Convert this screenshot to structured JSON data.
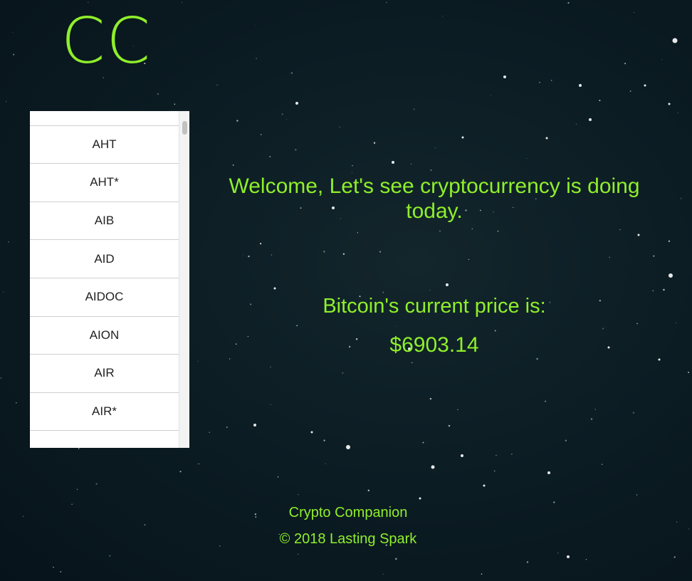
{
  "brand": {
    "logo_text": "CC",
    "accent_color": "#8fef2a"
  },
  "coin_list": {
    "items": [
      {
        "label": ""
      },
      {
        "label": "AHT"
      },
      {
        "label": "AHT*"
      },
      {
        "label": "AIB"
      },
      {
        "label": "AID"
      },
      {
        "label": "AIDOC"
      },
      {
        "label": "AION"
      },
      {
        "label": "AIR"
      },
      {
        "label": "AIR*"
      },
      {
        "label": ""
      }
    ]
  },
  "main": {
    "welcome_text": "Welcome, Let's see cryptocurrency is doing today.",
    "price_label": "Bitcoin's current price is:",
    "price_value": "$6903.14"
  },
  "footer": {
    "app_name": "Crypto Companion",
    "copyright": "© 2018 Lasting Spark"
  },
  "background": {
    "style": "starfield",
    "color": "#0c1d24"
  }
}
